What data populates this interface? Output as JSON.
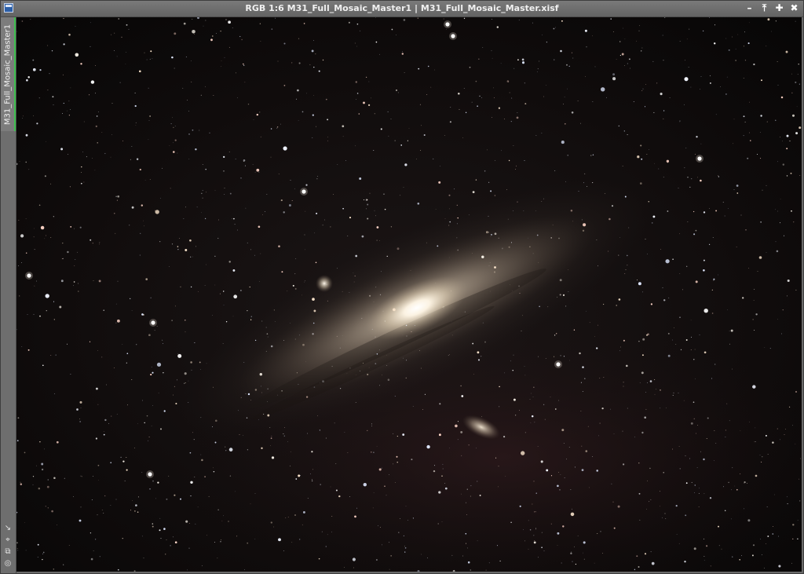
{
  "window": {
    "title": "RGB 1:6 M31_Full_Mosaic_Master1 | M31_Full_Mosaic_Master.xisf",
    "controls": [
      {
        "name": "minimize-button",
        "glyph": "–"
      },
      {
        "name": "shade-button",
        "glyph": "⤒"
      },
      {
        "name": "maximize-button",
        "glyph": "✚"
      },
      {
        "name": "close-button",
        "glyph": "✖"
      }
    ]
  },
  "sidebar": {
    "tab_label": "M31_Full_Mosaic_Master1",
    "tab_accent": "#3fbf4f",
    "tools": [
      {
        "name": "zoom-to-fit-icon",
        "glyph": "↘"
      },
      {
        "name": "crosshair-icon",
        "glyph": "⌖"
      },
      {
        "name": "clone-view-icon",
        "glyph": "⧉"
      },
      {
        "name": "options-icon",
        "glyph": "◎"
      }
    ]
  },
  "image": {
    "subject": "Andromeda galaxy (M31) star field",
    "background_color": "#0a0909"
  }
}
